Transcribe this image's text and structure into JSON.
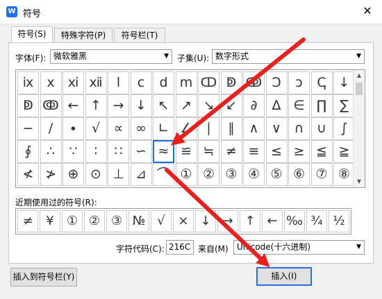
{
  "window": {
    "title": "符号",
    "close_glyph": "✕",
    "app_icon_glyph": "W"
  },
  "tabs": [
    {
      "label": "符号(S)",
      "active": true
    },
    {
      "label": "特殊字符(P)",
      "active": false
    },
    {
      "label": "符号栏(T)",
      "active": false
    }
  ],
  "font": {
    "label": "字体(F):",
    "value": "微软雅黑"
  },
  "subset": {
    "label": "子集(U):",
    "value": "数字形式"
  },
  "symbols": [
    [
      "ⅸ",
      "ⅹ",
      "ⅺ",
      "ⅻ",
      "ⅼ",
      "ⅽ",
      "ⅾ",
      "ⅿ",
      "ↀ",
      "ↁ",
      "ↂ",
      "Ↄ",
      "ↄ",
      "ↅ",
      "↓"
    ],
    [
      "ↁ",
      "ↂ",
      "←",
      "↑",
      "→",
      "↓",
      "↖",
      "↗",
      "↘",
      "↙",
      "∂",
      "∆",
      "∈",
      "∏",
      "∑"
    ],
    [
      "−",
      "∕",
      "∙",
      "√",
      "∝",
      "∞",
      "∟",
      "∠",
      "∣",
      "∥",
      "∧",
      "∨",
      "∩",
      "∪",
      "∫"
    ],
    [
      "∮",
      "∴",
      "∵",
      "∶",
      "∷",
      "∽",
      "≈",
      "≌",
      "≒",
      "≠",
      "≡",
      "≤",
      "≥",
      "≦",
      "≧"
    ],
    [
      "≮",
      "≯",
      "⊕",
      "⊙",
      "⊥",
      "⊿",
      "⌒",
      "①",
      "②",
      "③",
      "④",
      "⑤",
      "⑥",
      "⑦",
      "⑧"
    ]
  ],
  "selected": {
    "row": 3,
    "col": 6
  },
  "recent": {
    "label": "近期使用过的符号(R):",
    "items": [
      "≠",
      "¥",
      "①",
      "②",
      "③",
      "№",
      "√",
      "×",
      "↓",
      "→",
      "↑",
      "←",
      "‰",
      "¾",
      "½"
    ]
  },
  "char_code": {
    "label": "字符代码(C):",
    "value": "216C"
  },
  "from": {
    "label": "来自(M)",
    "value": "Unicode(十六进制)"
  },
  "buttons": {
    "insert_to_bar": "插入到符号栏(Y)",
    "insert": "插入(I)"
  },
  "arrow_color": "#e8201e"
}
